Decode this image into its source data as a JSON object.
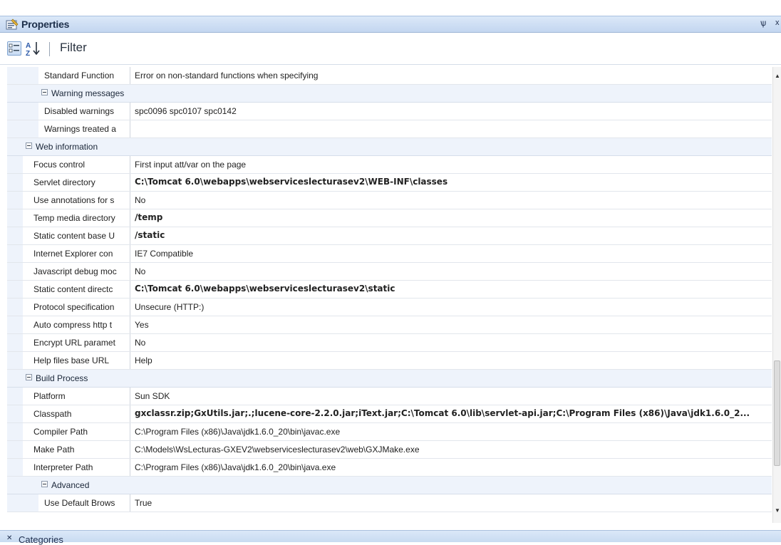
{
  "panel": {
    "title": "Properties",
    "pin_glyph": "ѱ",
    "close_glyph": "x"
  },
  "toolbar": {
    "filter_label": "Filter"
  },
  "rows": [
    {
      "kind": "prop",
      "level": 2,
      "name": "Standard Function",
      "value": "Error on non-standard functions when specifying",
      "bold": false
    },
    {
      "kind": "cat",
      "level": 1,
      "name": "Warning messages"
    },
    {
      "kind": "prop",
      "level": 2,
      "name": "Disabled warnings",
      "value": "spc0096 spc0107 spc0142",
      "bold": false
    },
    {
      "kind": "prop",
      "level": 2,
      "name": "Warnings treated a",
      "value": "",
      "bold": false
    },
    {
      "kind": "cat",
      "level": 0,
      "name": "Web information"
    },
    {
      "kind": "prop",
      "level": 1,
      "name": "Focus control",
      "value": "First input att/var on the page",
      "bold": false
    },
    {
      "kind": "prop",
      "level": 1,
      "name": "Servlet directory",
      "value": "C:\\Tomcat 6.0\\webapps\\webserviceslecturasev2\\WEB-INF\\classes",
      "bold": true
    },
    {
      "kind": "prop",
      "level": 1,
      "name": "Use annotations for s",
      "value": "No",
      "bold": false
    },
    {
      "kind": "prop",
      "level": 1,
      "name": "Temp media directory",
      "value": "/temp",
      "bold": true
    },
    {
      "kind": "prop",
      "level": 1,
      "name": "Static content base U",
      "value": "/static",
      "bold": true
    },
    {
      "kind": "prop",
      "level": 1,
      "name": "Internet Explorer con",
      "value": "IE7 Compatible",
      "bold": false
    },
    {
      "kind": "prop",
      "level": 1,
      "name": "Javascript debug moc",
      "value": "No",
      "bold": false
    },
    {
      "kind": "prop",
      "level": 1,
      "name": "Static content directc",
      "value": "C:\\Tomcat 6.0\\webapps\\webserviceslecturasev2\\static",
      "bold": true
    },
    {
      "kind": "prop",
      "level": 1,
      "name": "Protocol specification",
      "value": "Unsecure (HTTP:)",
      "bold": false
    },
    {
      "kind": "prop",
      "level": 1,
      "name": "Auto compress http t",
      "value": "Yes",
      "bold": false
    },
    {
      "kind": "prop",
      "level": 1,
      "name": "Encrypt URL paramet",
      "value": "No",
      "bold": false
    },
    {
      "kind": "prop",
      "level": 1,
      "name": "Help files base URL",
      "value": "Help",
      "bold": false
    },
    {
      "kind": "cat",
      "level": 0,
      "name": "Build Process"
    },
    {
      "kind": "prop",
      "level": 1,
      "name": "Platform",
      "value": "Sun SDK",
      "bold": false
    },
    {
      "kind": "prop",
      "level": 1,
      "name": "Classpath",
      "value": "gxclassr.zip;GxUtils.jar;.;lucene-core-2.2.0.jar;iText.jar;C:\\Tomcat 6.0\\lib\\servlet-api.jar;C:\\Program Files (x86)\\Java\\jdk1.6.0_2...",
      "bold": true
    },
    {
      "kind": "prop",
      "level": 1,
      "name": "Compiler Path",
      "value": "C:\\Program Files (x86)\\Java\\jdk1.6.0_20\\bin\\javac.exe",
      "bold": false
    },
    {
      "kind": "prop",
      "level": 1,
      "name": "Make Path",
      "value": "C:\\Models\\WsLecturas-GXEV2\\webserviceslecturasev2\\web\\GXJMake.exe",
      "bold": false
    },
    {
      "kind": "prop",
      "level": 1,
      "name": "Interpreter Path",
      "value": "C:\\Program Files (x86)\\Java\\jdk1.6.0_20\\bin\\java.exe",
      "bold": false
    },
    {
      "kind": "cat",
      "level": 1,
      "name": "Advanced"
    },
    {
      "kind": "prop",
      "level": 2,
      "name": "Use Default Brows",
      "value": "True",
      "bold": false
    }
  ],
  "bottom_bar": {
    "label": "Categories"
  },
  "colors": {
    "header_gradient_top": "#dbe8f8",
    "header_gradient_bottom": "#c3d6f0",
    "category_row": "#eef3fb"
  },
  "icons": [
    "properties-icon",
    "pin-icon",
    "close-icon",
    "categorized-icon",
    "alphabetical-sort-icon",
    "collapse-icon",
    "scroll-up-icon",
    "scroll-down-icon",
    "chevron-icon"
  ]
}
